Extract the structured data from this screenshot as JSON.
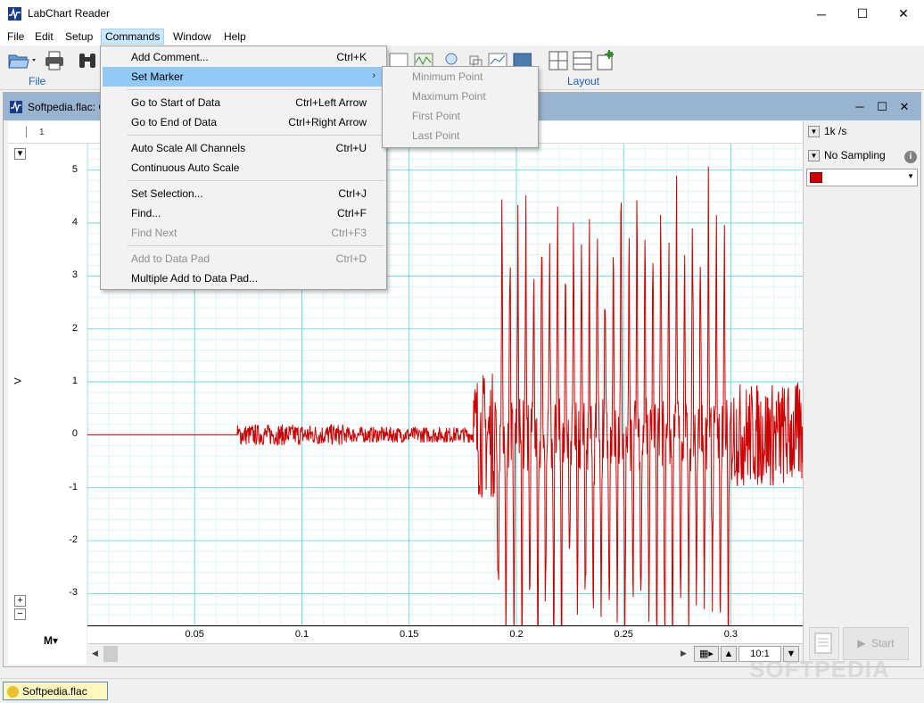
{
  "window": {
    "title": "LabChart Reader",
    "minimize": "─",
    "maximize": "☐",
    "close": "✕"
  },
  "menubar": [
    "File",
    "Edit",
    "Setup",
    "Commands",
    "Window",
    "Help"
  ],
  "toolbar": {
    "file_label": "File",
    "layout_label": "Layout"
  },
  "document": {
    "name": "Softpedia.flac: C",
    "ruler_mark": "1"
  },
  "rate": "1k /s",
  "sampling": "No Sampling",
  "channel_color": "#cc0000",
  "start_label": "Start",
  "zoom": "10:1",
  "status_tab": "Softpedia.flac",
  "watermark": "SOFTPEDIA",
  "commands_menu": [
    {
      "label": "Add Comment...",
      "shortcut": "Ctrl+K",
      "state": "normal"
    },
    {
      "label": "Set Marker",
      "shortcut": "",
      "state": "highlighted",
      "submenu": true
    },
    {
      "label": "Go to Start of Data",
      "shortcut": "Ctrl+Left Arrow",
      "state": "normal"
    },
    {
      "label": "Go to End of Data",
      "shortcut": "Ctrl+Right Arrow",
      "state": "normal"
    },
    {
      "label": "Auto Scale All Channels",
      "shortcut": "Ctrl+U",
      "state": "normal"
    },
    {
      "label": "Continuous Auto Scale",
      "shortcut": "",
      "state": "normal"
    },
    {
      "label": "Set Selection...",
      "shortcut": "Ctrl+J",
      "state": "normal"
    },
    {
      "label": "Find...",
      "shortcut": "Ctrl+F",
      "state": "normal"
    },
    {
      "label": "Find Next",
      "shortcut": "Ctrl+F3",
      "state": "disabled"
    },
    {
      "label": "Add to Data Pad",
      "shortcut": "Ctrl+D",
      "state": "disabled"
    },
    {
      "label": "Multiple Add to Data Pad...",
      "shortcut": "",
      "state": "normal"
    }
  ],
  "set_marker_submenu": [
    "Minimum Point",
    "Maximum Point",
    "First Point",
    "Last Point"
  ],
  "chart_data": {
    "type": "line",
    "ylabel": "V",
    "ylim": [
      -3.6,
      5.5
    ],
    "yticks": [
      "5",
      "4",
      "3",
      "2",
      "1",
      "0",
      "-1",
      "-2",
      "-3"
    ],
    "xlim": [
      0,
      0.3335
    ],
    "xticks": [
      "0.05",
      "0.1",
      "0.15",
      "0.2",
      "0.25",
      "0.3"
    ],
    "grid": true,
    "series": [
      {
        "color": "#cc0000",
        "segments": [
          {
            "from": 0.0,
            "to": 0.07,
            "amp": 0.0
          },
          {
            "from": 0.07,
            "to": 0.12,
            "amp": 0.2
          },
          {
            "from": 0.12,
            "to": 0.18,
            "amp": 0.15
          },
          {
            "from": 0.18,
            "to": 0.19,
            "amp": 1.2
          },
          {
            "from": 0.19,
            "to": 0.3,
            "amp": 4.5
          },
          {
            "from": 0.3,
            "to": 0.3335,
            "amp": 1.0
          }
        ]
      }
    ]
  }
}
